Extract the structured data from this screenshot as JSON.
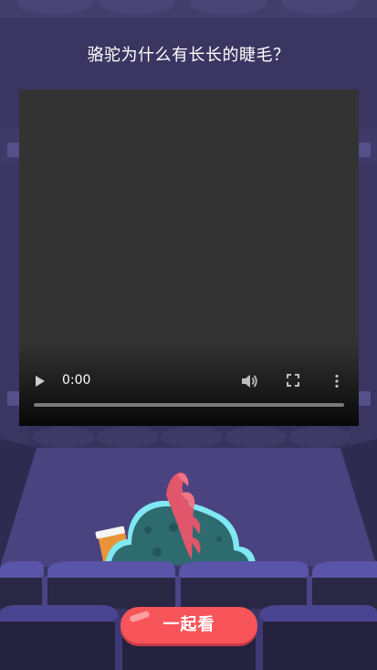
{
  "question_title": "骆驼为什么有长长的睫毛？",
  "video": {
    "current_time": "0:00",
    "controls": {
      "play": "play-icon",
      "volume": "volume-icon",
      "fullscreen": "fullscreen-icon",
      "more": "more-options-icon"
    },
    "progress": 0
  },
  "watch_together_button": "一起看",
  "colors": {
    "background": "#3a3561",
    "seat": "#4a4488",
    "button": "#f8555a",
    "dino_body": "#2d6b6f",
    "dino_outline": "#7fe8f2",
    "dino_spikes": "#e0566a"
  }
}
